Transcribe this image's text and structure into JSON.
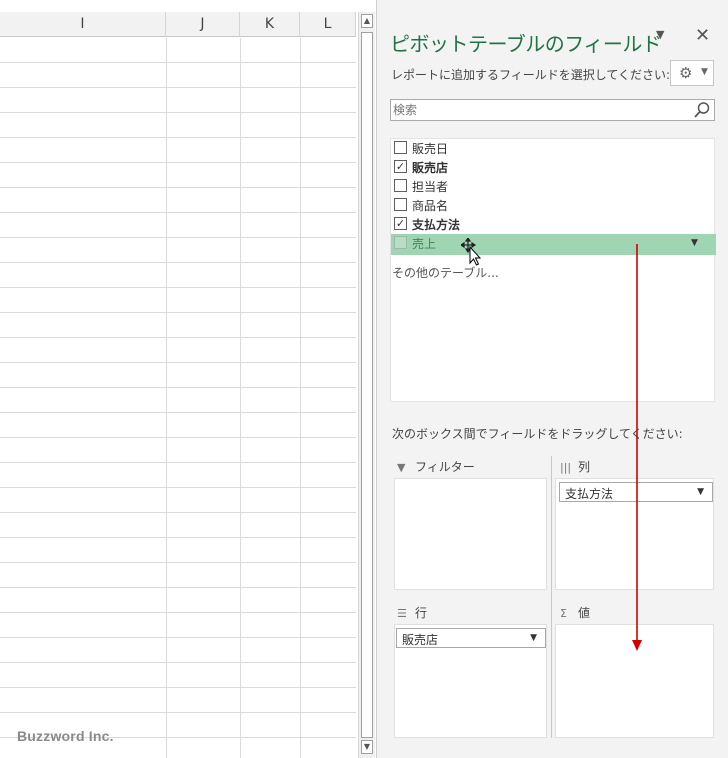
{
  "sheet": {
    "columns": [
      "I",
      "J",
      "K",
      "L"
    ],
    "watermark": "Buzzword Inc."
  },
  "pane": {
    "title": "ピボットテーブルのフィールド",
    "subtitle": "レポートに追加するフィールドを選択してください:",
    "search_placeholder": "検索",
    "fields": [
      {
        "label": "販売日",
        "checked": false
      },
      {
        "label": "販売店",
        "checked": true
      },
      {
        "label": "担当者",
        "checked": false
      },
      {
        "label": "商品名",
        "checked": false
      },
      {
        "label": "支払方法",
        "checked": true
      },
      {
        "label": "売上",
        "checked": false,
        "dragging": true
      }
    ],
    "more_tables": "その他のテーブル...",
    "drag_hint": "次のボックス間でフィールドをドラッグしてください:",
    "areas": {
      "filter": {
        "label": "フィルター",
        "icon": "filter-icon"
      },
      "columns": {
        "label": "列",
        "icon": "columns-icon",
        "items": [
          "支払方法"
        ]
      },
      "rows": {
        "label": "行",
        "icon": "rows-icon",
        "items": [
          "販売店"
        ]
      },
      "values": {
        "label": "値",
        "icon": "sigma-icon",
        "items": []
      }
    },
    "accent_color": "#217346",
    "drag_highlight_color": "#9fd5b3",
    "arrow_color": "#d40000"
  }
}
